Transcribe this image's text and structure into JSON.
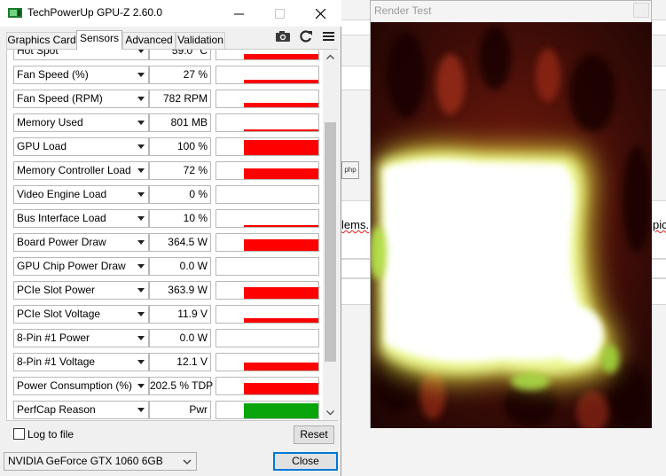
{
  "gpuz": {
    "title": "TechPowerUp GPU-Z 2.60.0",
    "tabs": [
      {
        "label": "Graphics Card"
      },
      {
        "label": "Sensors"
      },
      {
        "label": "Advanced"
      },
      {
        "label": "Validation"
      }
    ],
    "active_tab": "Sensors",
    "sensors": [
      {
        "name": "Hot Spot",
        "value": "59.0 °C",
        "graph_level": 0.35,
        "graph_color": "#ff0000"
      },
      {
        "name": "Fan Speed (%)",
        "value": "27 %",
        "graph_level": 0.22,
        "graph_color": "#ff0000"
      },
      {
        "name": "Fan Speed (RPM)",
        "value": "782 RPM",
        "graph_level": 0.3,
        "graph_color": "#ff0000"
      },
      {
        "name": "Memory Used",
        "value": "801 MB",
        "graph_level": 0.1,
        "graph_color": "#ff0000"
      },
      {
        "name": "GPU Load",
        "value": "100 %",
        "graph_level": 1.0,
        "graph_color": "#ff0000"
      },
      {
        "name": "Memory Controller Load",
        "value": "72 %",
        "graph_level": 0.72,
        "graph_color": "#ff0000"
      },
      {
        "name": "Video Engine Load",
        "value": "0 %",
        "graph_level": 0.0,
        "graph_color": "#ff0000"
      },
      {
        "name": "Bus Interface Load",
        "value": "10 %",
        "graph_level": 0.1,
        "graph_color": "#ff0000"
      },
      {
        "name": "Board Power Draw",
        "value": "364.5 W",
        "graph_level": 0.78,
        "graph_color": "#ff0000"
      },
      {
        "name": "GPU Chip Power Draw",
        "value": "0.0 W",
        "graph_level": 0.0,
        "graph_color": "#ff0000"
      },
      {
        "name": "PCIe Slot Power",
        "value": "363.9 W",
        "graph_level": 0.78,
        "graph_color": "#ff0000"
      },
      {
        "name": "PCIe Slot Voltage",
        "value": "11.9 V",
        "graph_level": 0.3,
        "graph_color": "#ff0000"
      },
      {
        "name": "8-Pin #1 Power",
        "value": "0.0 W",
        "graph_level": 0.0,
        "graph_color": "#ff0000"
      },
      {
        "name": "8-Pin #1 Voltage",
        "value": "12.1 V",
        "graph_level": 0.5,
        "graph_color": "#ff0000"
      },
      {
        "name": "Power Consumption (%)",
        "value": "202.5 % TDP",
        "graph_level": 0.78,
        "graph_color": "#ff0000"
      },
      {
        "name": "PerfCap Reason",
        "value": "Pwr",
        "graph_level": 1.0,
        "graph_color": "#0aa50a"
      }
    ],
    "log_to_file_label": "Log to file",
    "log_to_file_checked": false,
    "reset_label": "Reset",
    "gpu_select": "NVIDIA GeForce GTX 1060 6GB",
    "close_label": "Close",
    "icons": {
      "camera": "camera-icon",
      "refresh": "refresh-icon",
      "menu": "hamburger-menu-icon"
    }
  },
  "render": {
    "title": "Render Test"
  },
  "background": {
    "frag_left": "lems.",
    "frag_right": "pic",
    "frag_btn": "php"
  }
}
